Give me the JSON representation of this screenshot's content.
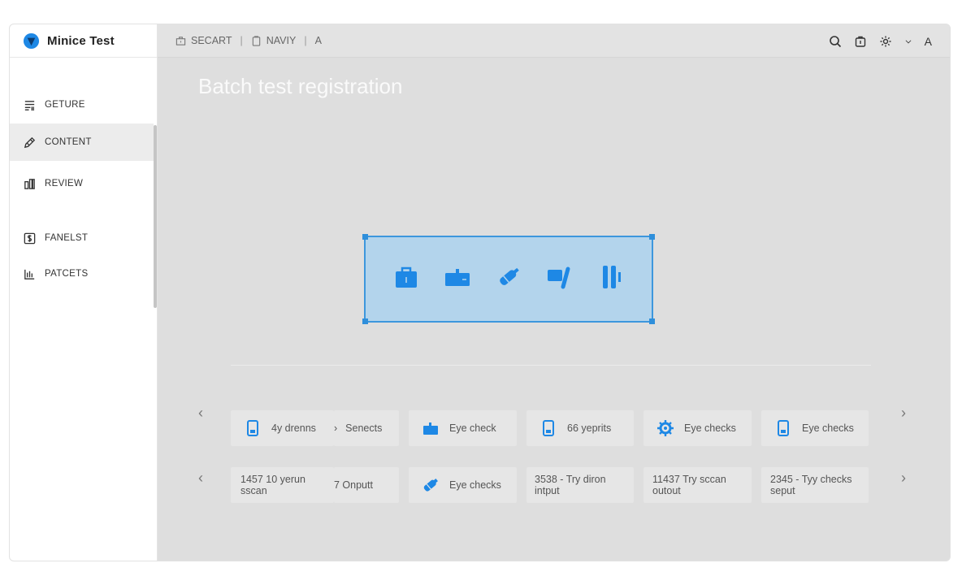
{
  "app": {
    "name": "Minice Test"
  },
  "sidebar": {
    "items": [
      {
        "label": "GETURE",
        "icon": "list-icon",
        "active": false
      },
      {
        "label": "CONTENT",
        "icon": "pencil-icon",
        "active": true
      },
      {
        "label": "REVIEW",
        "icon": "bars-icon",
        "active": false
      },
      {
        "label": "FANELST",
        "icon": "dollar-doc-icon",
        "active": false
      },
      {
        "label": "PATCETS",
        "icon": "chart-icon",
        "active": false
      }
    ]
  },
  "topbar": {
    "crumbs": [
      {
        "label": "SECART",
        "icon": "briefcase-icon"
      },
      {
        "label": "NAVIY",
        "icon": "clipboard-icon"
      },
      {
        "label": "A"
      }
    ],
    "avatar": "A"
  },
  "main": {
    "title": "Batch test registration",
    "row1": [
      {
        "icon": "phone-icon",
        "lines": [
          "4y drenns"
        ]
      },
      {
        "icon": "",
        "lines": [
          "Senects"
        ],
        "prefix": "›"
      },
      {
        "icon": "case-icon",
        "lines": [
          "Eye check"
        ]
      },
      {
        "icon": "phone-icon",
        "lines": [
          "66 yeprits"
        ]
      },
      {
        "icon": "gear-icon",
        "lines": [
          "Eye checks"
        ]
      },
      {
        "icon": "phone-icon",
        "lines": [
          "Eye checks"
        ]
      }
    ],
    "row2": [
      {
        "icon": "",
        "lines": [
          "1457  10 yerun",
          "sscan"
        ]
      },
      {
        "icon": "",
        "lines": [
          "7  Onputt"
        ]
      },
      {
        "icon": "syringe-icon",
        "lines": [
          "Eye checks"
        ]
      },
      {
        "icon": "",
        "lines": [
          "3538 - Try diron",
          "intput"
        ]
      },
      {
        "icon": "",
        "lines": [
          "11437  Try sccan",
          "outout"
        ]
      },
      {
        "icon": "",
        "lines": [
          "2345 - Tyy checks",
          "seput"
        ]
      }
    ]
  },
  "colors": {
    "accent": "#1e88e5",
    "selection_bg": "#b3d4ec"
  }
}
